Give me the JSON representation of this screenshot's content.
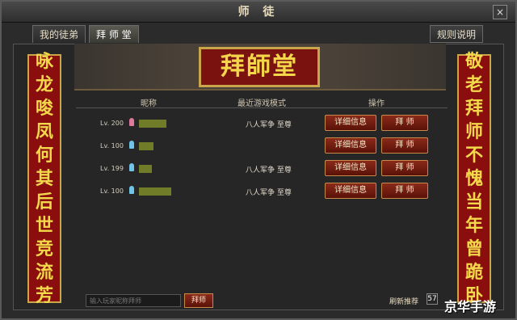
{
  "window": {
    "title": "师 徒"
  },
  "tabs": [
    {
      "label": "我的徒弟"
    },
    {
      "label": "拜 师 堂"
    }
  ],
  "rules_label": "规则说明",
  "plaque_text": "拜師堂",
  "banners": {
    "left": [
      "咏",
      "龙",
      "唆",
      "凤",
      "何",
      "其",
      "后",
      "世",
      "竞",
      "流",
      "芳"
    ],
    "right": [
      "敬",
      "老",
      "拜",
      "师",
      "不",
      "愧",
      "当",
      "年",
      "曾",
      "跪",
      "卧"
    ]
  },
  "table": {
    "headers": {
      "name": "昵称",
      "mode": "最近游戏模式",
      "op": "操作"
    },
    "rows": [
      {
        "level": "Lv. 200",
        "gender": "female",
        "nickname": "",
        "mode": "八人军争  至尊",
        "detail_label": "详细信息",
        "apprentice_label": "拜  师"
      },
      {
        "level": "Lv. 100",
        "gender": "male",
        "nickname": "",
        "mode": "",
        "detail_label": "详细信息",
        "apprentice_label": "拜  师"
      },
      {
        "level": "Lv. 199",
        "gender": "male",
        "nickname": "",
        "mode": "八人军争  至尊",
        "detail_label": "详细信息",
        "apprentice_label": "拜  师"
      },
      {
        "level": "Lv. 100",
        "gender": "male",
        "nickname": "",
        "mode": "八人军争  至尊",
        "detail_label": "详细信息",
        "apprentice_label": "拜  师"
      }
    ]
  },
  "footer": {
    "search_placeholder": "输入玩家昵称拜师",
    "search_button": "拜师",
    "refresh_label": "刷新推荐",
    "refresh_count": "57"
  },
  "watermark": "京华手游",
  "colors": {
    "banner_bg": "#8a0e0e",
    "banner_text": "#f2d84a",
    "button_bg": "#7a1e10"
  }
}
